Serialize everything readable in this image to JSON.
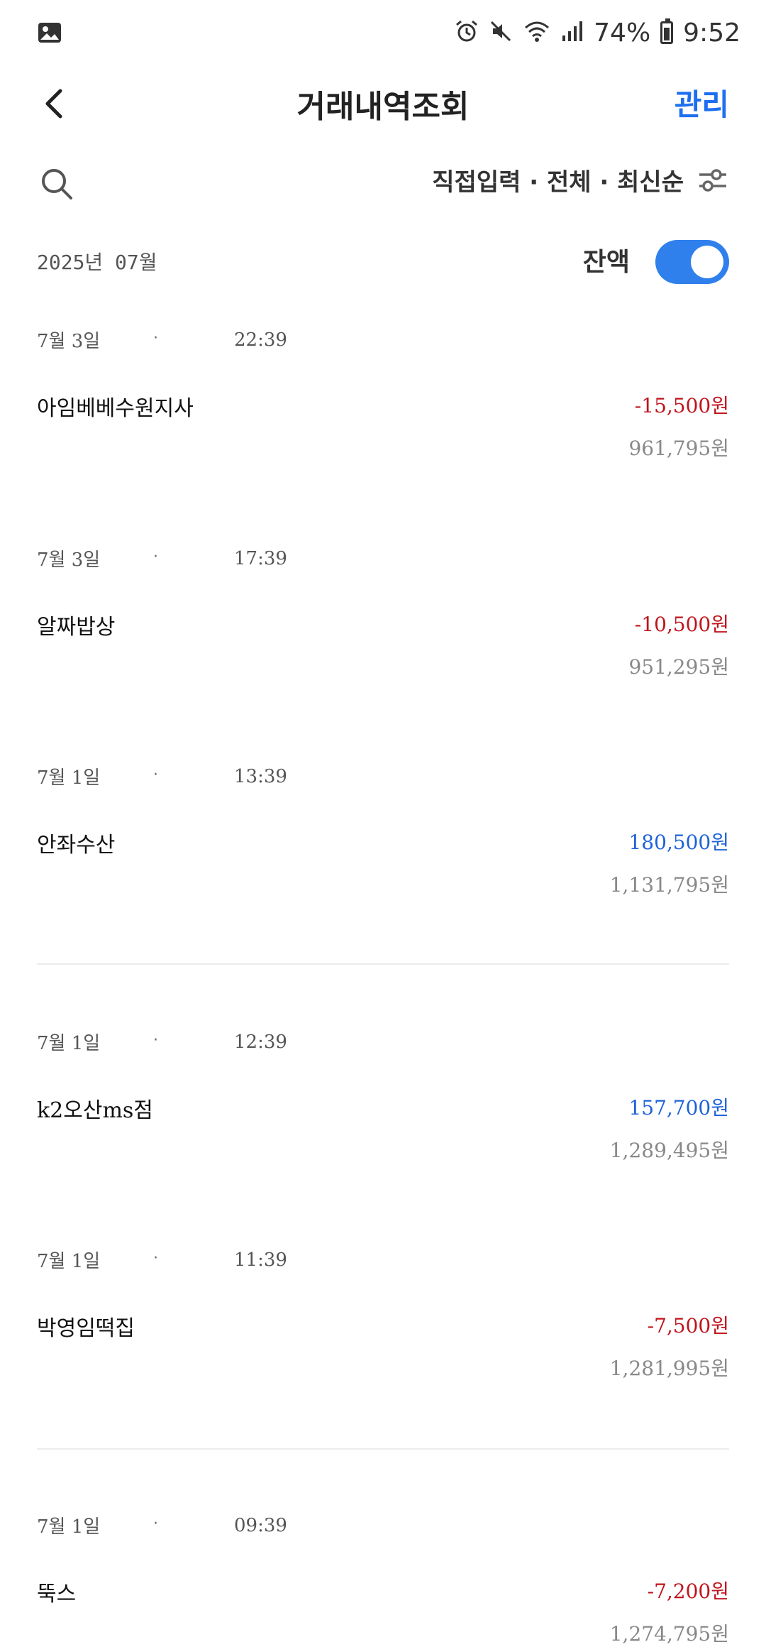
{
  "statusbar": {
    "battery_text": "74%",
    "time": "9:52",
    "icons": [
      "gallery-icon",
      "alarm-icon",
      "mute-icon",
      "wifi-icon",
      "signal-icon",
      "battery-icon"
    ]
  },
  "header": {
    "title": "거래내역조회",
    "manage_label": "관리"
  },
  "filter": {
    "label": "직접입력 · 전체 · 최신순"
  },
  "month": {
    "label": "2025년 07월",
    "balance_label": "잔액",
    "balance_toggle_on": true
  },
  "colors": {
    "accent": "#1e6ff0",
    "toggle": "#2f80ed",
    "negative": "#c0141c",
    "positive": "#1e62d9"
  },
  "transactions": [
    {
      "date": "7월 3일",
      "dot": "·",
      "time": "22:39",
      "name": "아임베베수원지사",
      "amount": "-15,500원",
      "balance": "961,795원",
      "type": "neg"
    },
    {
      "date": "7월 3일",
      "dot": "·",
      "time": "17:39",
      "name": "알짜밥상",
      "amount": "-10,500원",
      "balance": "951,295원",
      "type": "neg"
    },
    {
      "date": "7월 1일",
      "dot": "·",
      "time": "13:39",
      "name": "안좌수산",
      "amount": "180,500원",
      "balance": "1,131,795원",
      "type": "pos"
    },
    {
      "date": "7월 1일",
      "dot": "·",
      "time": "12:39",
      "name": "k2오산ms점",
      "amount": "157,700원",
      "balance": "1,289,495원",
      "type": "pos"
    },
    {
      "date": "7월 1일",
      "dot": "·",
      "time": "11:39",
      "name": "박영임떡집",
      "amount": "-7,500원",
      "balance": "1,281,995원",
      "type": "neg"
    },
    {
      "date": "7월 1일",
      "dot": "·",
      "time": "09:39",
      "name": "뚝스",
      "amount": "-7,200원",
      "balance": "1,274,795원",
      "type": "neg"
    }
  ]
}
